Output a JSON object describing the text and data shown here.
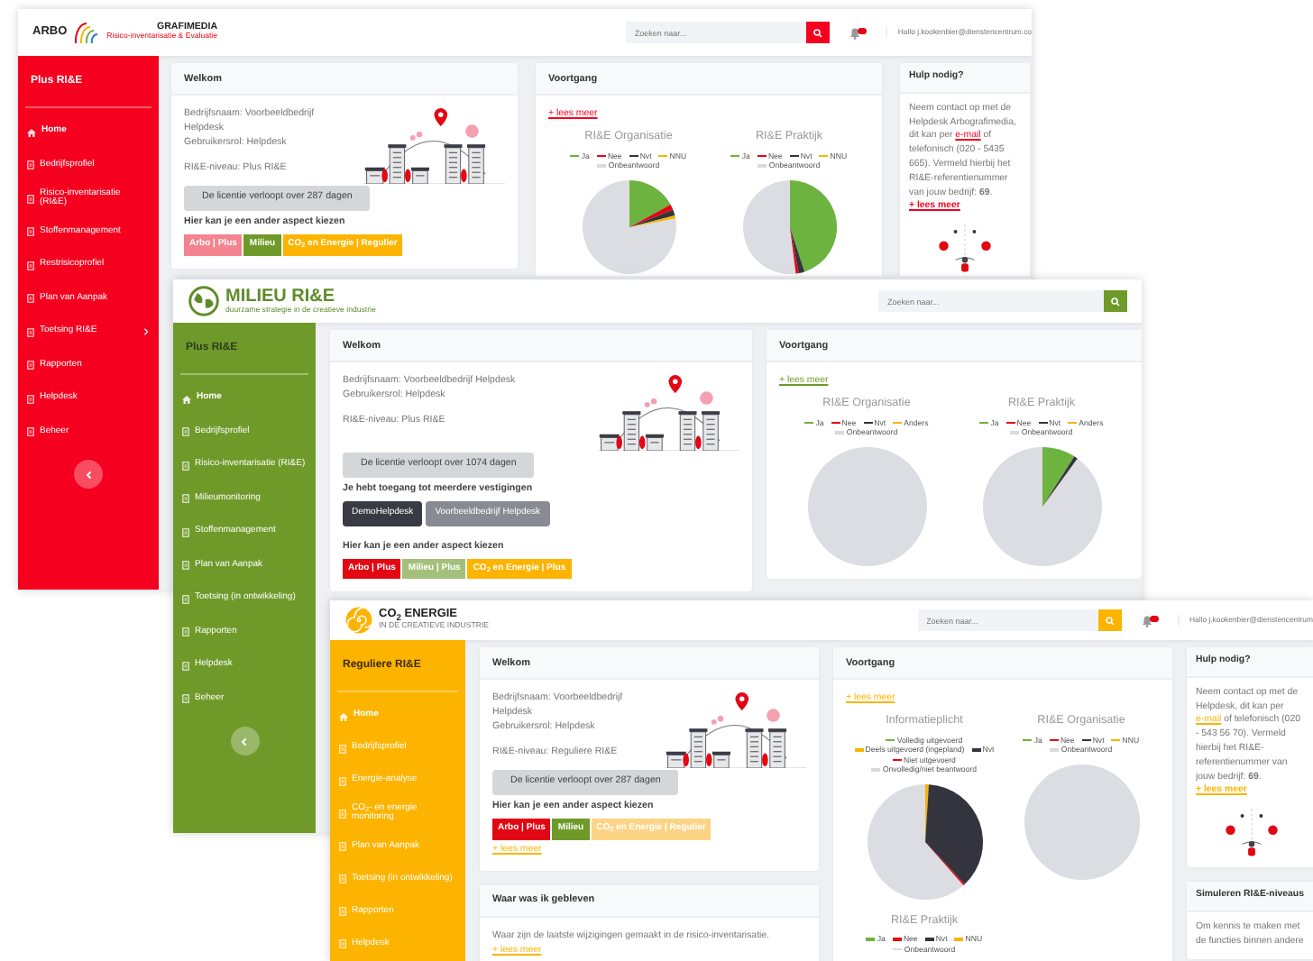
{
  "windows": [
    {
      "kind": "arbo",
      "color": "#f5001e",
      "header": {
        "logo": {
          "texts": [
            "ARBO",
            "GRAFIMEDIA"
          ],
          "tagline": "Risico-inventarisatie & Evaluatie"
        },
        "search": {
          "placeholder": "Zoeken naar..."
        },
        "notifications": true,
        "user": "Hallo j.kookenbier@dienstencentrum.co"
      },
      "sidebar": {
        "title": "Plus RI&E",
        "collapse_button": true,
        "items": [
          {
            "label": "Home",
            "selected": true,
            "submenu": false
          },
          {
            "label": "Bedrijfsprofiel",
            "selected": false,
            "submenu": false
          },
          {
            "label": "Risico-inventarisatie (RI&E)",
            "selected": false,
            "submenu": false
          },
          {
            "label": "Stoffenmanagement",
            "selected": false,
            "submenu": false
          },
          {
            "label": "Restrisicoprofiel",
            "selected": false,
            "submenu": false
          },
          {
            "label": "Plan van Aanpak",
            "selected": false,
            "submenu": false
          },
          {
            "label": "Toetsing RI&E",
            "selected": false,
            "submenu": true
          },
          {
            "label": "Rapporten",
            "selected": false,
            "submenu": false
          },
          {
            "label": "Helpdesk",
            "selected": false,
            "submenu": false
          },
          {
            "label": "Beheer",
            "selected": false,
            "submenu": false
          }
        ]
      },
      "columns": [
        [
          {
            "kind": "welcome",
            "title": "Welkom",
            "lines": [
              "Bedrijfsnaam: Voorbeeldbedrijf Helpdesk",
              "Gebruikersrol: Helpdesk",
              "RI&E-niveau: Plus RI&E"
            ],
            "license": "De licentie verloopt over 287 dagen",
            "aspects_label": "Hier kan je een ander aspect kiezen",
            "aspects": [
              {
                "label": "Arbo | Plus",
                "color": "#f3838e"
              },
              {
                "label": "Milieu",
                "color": "#6f9a2a"
              },
              {
                "label": "CO$_{2}$ en Energie | Regulier",
                "color": "#fdb400"
              }
            ]
          }
        ],
        [
          {
            "kind": "progress",
            "title": "Voortgang",
            "more": "+ lees meer",
            "charts": [
              {
                "title": "RI&E Organisatie",
                "legend": [
                  {
                    "label": "Ja",
                    "color": "#6db33f"
                  },
                  {
                    "label": "Nee",
                    "color": "#e30613"
                  },
                  {
                    "label": "Nvt",
                    "color": "#34343e"
                  },
                  {
                    "label": "NNU",
                    "color": "#f7b500"
                  },
                  {
                    "label": "Onbeantwoord",
                    "color": "#d9dadf"
                  }
                ]
              },
              {
                "title": "RI&E Praktijk",
                "legend": [
                  {
                    "label": "Ja",
                    "color": "#6db33f"
                  },
                  {
                    "label": "Nee",
                    "color": "#e30613"
                  },
                  {
                    "label": "Nvt",
                    "color": "#34343e"
                  },
                  {
                    "label": "NNU",
                    "color": "#f7b500"
                  },
                  {
                    "label": "Onbeantwoord",
                    "color": "#d9dadf"
                  }
                ]
              }
            ]
          }
        ],
        [
          {
            "kind": "help",
            "title": "Hulp nodig?",
            "text_before": "Neem contact op met de Helpdesk Arbografimedia, dit kan per",
            "link": "e-mail",
            "text_after": "of telefonisch (020 - 5435 665). Vermeld hierbij het RI&E-referentienummer van jouw bedrijf: **69**.",
            "more": "+ lees meer"
          }
        ]
      ]
    },
    {
      "kind": "milieu",
      "color": "#6f9a2a",
      "header": {
        "logo": {
          "texts": [
            "MILIEU RI&E"
          ],
          "tagline": "duurzame strategie in de creatieve industrie"
        },
        "search": {
          "placeholder": "Zoeken naar..."
        }
      },
      "sidebar": {
        "title": "Plus RI&E",
        "collapse_button": true,
        "items": [
          {
            "label": "Home",
            "selected": true,
            "submenu": false
          },
          {
            "label": "Bedrijfsprofiel",
            "selected": false,
            "submenu": false
          },
          {
            "label": "Risico-inventarisatie (RI&E)",
            "selected": false,
            "submenu": false
          },
          {
            "label": "Milieumonitoring",
            "selected": false,
            "submenu": false
          },
          {
            "label": "Stoffenmanagement",
            "selected": false,
            "submenu": false
          },
          {
            "label": "Plan van Aanpak",
            "selected": false,
            "submenu": false
          },
          {
            "label": "Toetsing (in ontwikkeling)",
            "selected": false,
            "submenu": false
          },
          {
            "label": "Rapporten",
            "selected": false,
            "submenu": false
          },
          {
            "label": "Helpdesk",
            "selected": false,
            "submenu": false
          },
          {
            "label": "Beheer",
            "selected": false,
            "submenu": false
          }
        ]
      },
      "columns": [
        [
          {
            "kind": "welcome",
            "title": "Welkom",
            "lines": [
              "Bedrijfsnaam: Voorbeeldbedrijf Helpdesk",
              "Gebruikersrol: Helpdesk",
              "RI&E-niveau: Plus RI&E"
            ],
            "license": "De licentie verloopt over 1074 dagen",
            "branches": {
              "label": "Je hebt toegang tot meerdere vestigingen",
              "buttons": [
                {
                  "label": "DemoHelpdesk",
                  "selected": true
                },
                {
                  "label": "Voorbeeldbedrijf Helpdesk",
                  "selected": false
                }
              ]
            },
            "aspects_label": "Hier kan je een ander aspect kiezen",
            "aspects": [
              {
                "label": "Arbo | Plus",
                "color": "#e30613"
              },
              {
                "label": "Milieu | Plus",
                "color": "#a3c07a"
              },
              {
                "label": "CO$_{2}$ en Energie | Plus",
                "color": "#fdb400"
              }
            ]
          }
        ],
        [
          {
            "kind": "progress",
            "title": "Voortgang",
            "more": "+ lees meer",
            "charts": [
              {
                "title": "RI&E Organisatie",
                "legend": [
                  {
                    "label": "Ja",
                    "color": "#6db33f"
                  },
                  {
                    "label": "Nee",
                    "color": "#e30613"
                  },
                  {
                    "label": "Nvt",
                    "color": "#34343e"
                  },
                  {
                    "label": "Anders",
                    "color": "#f7b500"
                  },
                  {
                    "label": "Onbeantwoord",
                    "color": "#d9dadf"
                  }
                ]
              },
              {
                "title": "RI&E Praktijk",
                "legend": [
                  {
                    "label": "Ja",
                    "color": "#6db33f"
                  },
                  {
                    "label": "Nee",
                    "color": "#e30613"
                  },
                  {
                    "label": "Nvt",
                    "color": "#34343e"
                  },
                  {
                    "label": "Anders",
                    "color": "#f7b500"
                  },
                  {
                    "label": "Onbeantwoord",
                    "color": "#d9dadf"
                  }
                ]
              }
            ]
          }
        ]
      ]
    },
    {
      "kind": "energie",
      "color": "#fdb400",
      "header": {
        "logo": {
          "texts": [
            "CO$_{2}$ ENERGIE"
          ],
          "tagline": "IN DE CREATIEVE INDUSTRIE"
        },
        "search": {
          "placeholder": "Zoeken naar..."
        },
        "notifications": true,
        "user": "Hallo j.kookenbier@dienstencentrum"
      },
      "sidebar": {
        "title": "Reguliere RI&E",
        "items": [
          {
            "label": "Home",
            "selected": true,
            "submenu": false
          },
          {
            "label": "Bedrijfsprofiel",
            "selected": false,
            "submenu": false
          },
          {
            "label": "Energie-analyse",
            "selected": false,
            "submenu": false
          },
          {
            "label": "CO$_{2}$- en energie monitoring",
            "selected": false,
            "submenu": false
          },
          {
            "label": "Plan van Aanpak",
            "selected": false,
            "submenu": false
          },
          {
            "label": "Toetsing (in ontwikkeling)",
            "selected": false,
            "submenu": false
          },
          {
            "label": "Rapporten",
            "selected": false,
            "submenu": false
          },
          {
            "label": "Helpdesk",
            "selected": false,
            "submenu": false
          }
        ]
      },
      "columns": [
        [
          {
            "kind": "welcome",
            "title": "Welkom",
            "lines": [
              "Bedrijfsnaam: Voorbeeldbedrijf Helpdesk",
              "Gebruikersrol: Helpdesk",
              "RI&E-niveau: Reguliere RI&E"
            ],
            "license": "De licentie verloopt over 287 dagen",
            "aspects_label": "Hier kan je een ander aspect kiezen",
            "aspects": [
              {
                "label": "Arbo | Plus",
                "color": "#e30613"
              },
              {
                "label": "Milieu",
                "color": "#6f9a2a"
              },
              {
                "label": "CO$_{2}$ en Energie | Regulier",
                "color": "#fdd486"
              }
            ],
            "more": "+ lees meer"
          },
          {
            "kind": "text",
            "title": "Waar was ik gebleven",
            "text": "Waar zijn de laatste wijzigingen gemaakt in de risico-inventarisatie.",
            "more": "+ lees meer"
          }
        ],
        [
          {
            "kind": "progress",
            "title": "Voortgang",
            "more": "+ lees meer",
            "charts": [
              {
                "title": "Informatieplicht",
                "legend": [
                  {
                    "label": "Volledig uitgevoerd",
                    "color": "#6db33f"
                  },
                  {
                    "label": "Deels uitgevoerd (ingepland)",
                    "color": "#f7b500"
                  },
                  {
                    "label": "Nvt",
                    "color": "#34343e"
                  },
                  {
                    "label": "Niet uitgevoerd",
                    "color": "#e30613"
                  },
                  {
                    "label": "Onvolledig/niet beantwoord",
                    "color": "#d9dadf"
                  }
                ]
              },
              {
                "title": "RI&E Organisatie",
                "legend": [
                  {
                    "label": "Ja",
                    "color": "#6db33f"
                  },
                  {
                    "label": "Nee",
                    "color": "#e30613"
                  },
                  {
                    "label": "Nvt",
                    "color": "#34343e"
                  },
                  {
                    "label": "NNU",
                    "color": "#f7b500"
                  },
                  {
                    "label": "Onbeantwoord",
                    "color": "#d9dadf"
                  }
                ]
              },
              {
                "title": "RI&E Praktijk",
                "legend": [
                  {
                    "label": "Ja",
                    "color": "#6db33f"
                  },
                  {
                    "label": "Nee",
                    "color": "#e30613"
                  },
                  {
                    "label": "Nvt",
                    "color": "#34343e"
                  },
                  {
                    "label": "NNU",
                    "color": "#f7b500"
                  },
                  {
                    "label": "Onbeantwoord",
                    "color": "#d9dadf"
                  }
                ]
              }
            ]
          }
        ],
        [
          {
            "kind": "help",
            "title": "Hulp nodig?",
            "text_before": "Neem contact op met de Helpdesk, dit kan per",
            "link": "e-mail",
            "text_after": "of telefonisch (020 - 543 56 70). Vermeld hierbij het RI&E-referentienummer van jouw bedrijf: **69**.",
            "more": "+ lees meer"
          },
          {
            "kind": "text",
            "title": "Simuleren RI&E-niveaus",
            "text": "Om kennis te maken met de functies binnen andere"
          }
        ]
      ]
    }
  ]
}
